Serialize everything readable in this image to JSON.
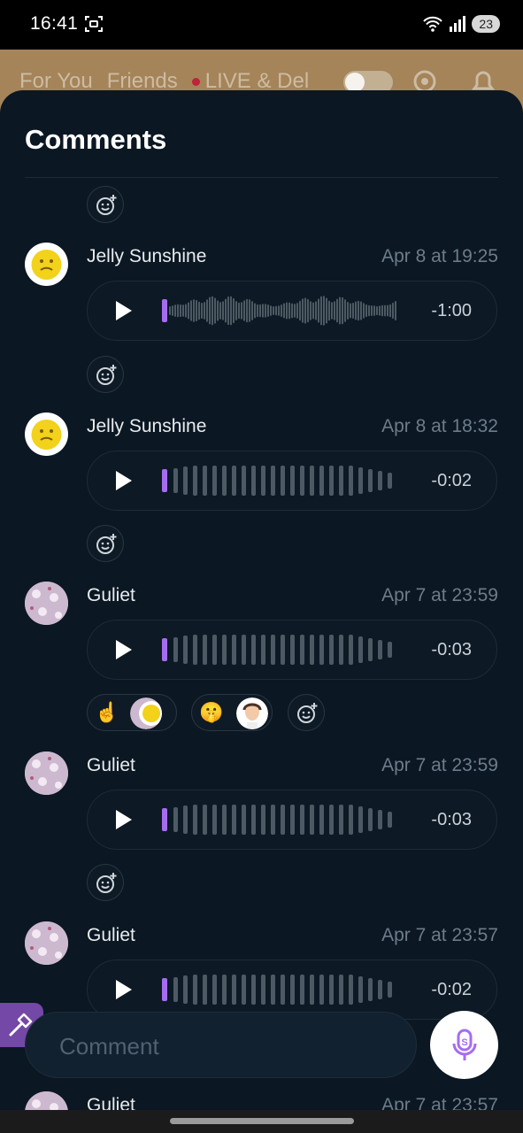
{
  "status_bar": {
    "time": "16:41",
    "battery": "23"
  },
  "feed_tabs": [
    "For You",
    "Friends",
    "LIVE & Del"
  ],
  "sheet": {
    "title": "Comments"
  },
  "comments": [
    {
      "author": "Jelly Sunshine",
      "time": "Apr 8 at 19:25",
      "duration": "-1:00",
      "avatar": "yellow-emoji-avatar"
    },
    {
      "author": "Jelly Sunshine",
      "time": "Apr 8 at 18:32",
      "duration": "-0:02",
      "avatar": "yellow-emoji-avatar"
    },
    {
      "author": "Guliet",
      "time": "Apr 7 at 23:59",
      "duration": "-0:03",
      "avatar": "pink-pattern-avatar",
      "reactions": [
        {
          "emoji": "☝️"
        },
        {
          "emoji": "🤫"
        }
      ]
    },
    {
      "author": "Guliet",
      "time": "Apr 7 at 23:59",
      "duration": "-0:03",
      "avatar": "pink-pattern-avatar"
    },
    {
      "author": "Guliet",
      "time": "Apr 7 at 23:57",
      "duration": "-0:02",
      "avatar": "pink-pattern-avatar"
    },
    {
      "author": "Guliet",
      "time": "Apr 7 at 23:57",
      "avatar": "pink-pattern-avatar"
    }
  ],
  "composer": {
    "placeholder": "Comment"
  },
  "colors": {
    "accent": "#a56cf0",
    "sheet_bg": "#0b1722",
    "wave": "#4e5a63"
  }
}
